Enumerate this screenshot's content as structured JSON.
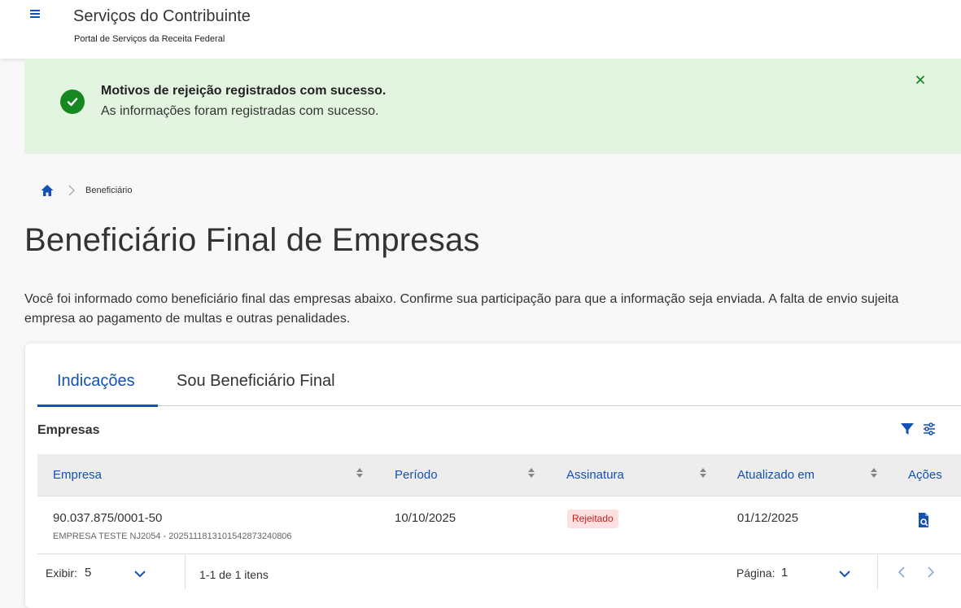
{
  "header": {
    "title": "Serviços do Contribuinte",
    "subtitle": "Portal de Serviços da Receita Federal"
  },
  "alert": {
    "title": "Motivos de rejeição registrados com sucesso.",
    "message": "As informações foram registradas com sucesso.",
    "close_label": "×"
  },
  "breadcrumb": {
    "items": [
      "Beneficiário"
    ]
  },
  "page": {
    "title": "Beneficiário Final de Empresas",
    "description_line1": "Você foi informado como beneficiário final das empresas abaixo. Confirme sua participação para que a informação seja enviada. A falta de envio sujeita",
    "description_line2": "empresa ao pagamento de multas e outras penalidades."
  },
  "tabs": [
    {
      "label": "Indicações",
      "active": true
    },
    {
      "label": "Sou Beneficiário Final",
      "active": false
    }
  ],
  "table": {
    "section_title": "Empresas",
    "columns": [
      "Empresa",
      "Período",
      "Assinatura",
      "Atualizado em",
      "Ações"
    ],
    "rows": [
      {
        "empresa": "90.037.875/0001-50",
        "empresa_sub": "EMPRESA TESTE NJ2054 - 20251118131015428732​40806",
        "periodo": "10/10/2025",
        "assinatura": "Rejeitado",
        "atualizado": "01/12/2025"
      }
    ]
  },
  "pagination": {
    "show_label": "Exibir:",
    "show_value": "5",
    "range_text": "1-1 de 1 itens",
    "page_label": "Página:",
    "page_value": "1"
  },
  "colors": {
    "primary": "#1351b4",
    "success": "#168821",
    "alert_bg": "#e3f5e1",
    "badge_bg": "#fde0e0",
    "badge_text": "#c81c1c"
  }
}
